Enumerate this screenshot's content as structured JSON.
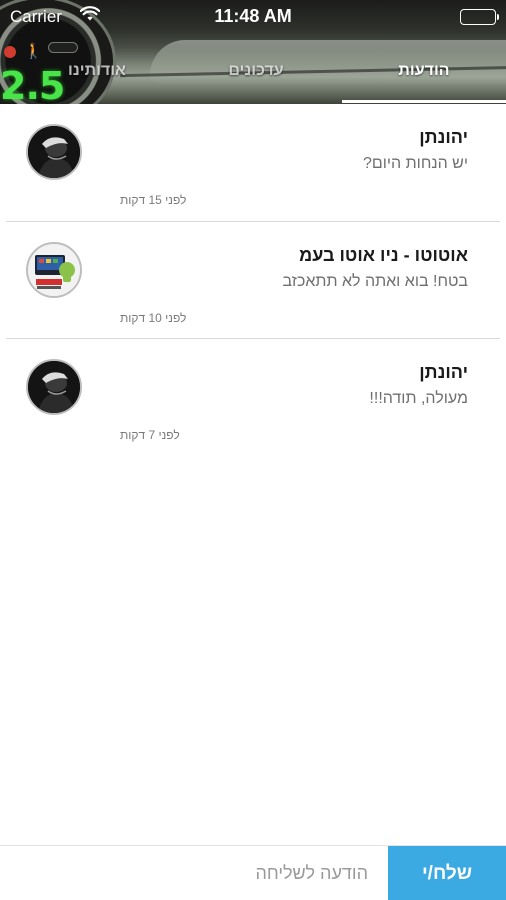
{
  "status_bar": {
    "carrier": "Carrier",
    "time": "11:48 AM",
    "icons": [
      "wifi-icon",
      "battery-icon"
    ]
  },
  "header": {
    "gauge_text": "2.5",
    "tabs": [
      {
        "label": "הודעות",
        "selected": true
      },
      {
        "label": "עדכונים",
        "selected": false
      },
      {
        "label": "אודותינו",
        "selected": false
      }
    ]
  },
  "messages": [
    {
      "name": "יהונתן",
      "preview": "יש הנחות היום?",
      "time": "לפני 15 דקות",
      "avatar": "person-photo"
    },
    {
      "name": "אוטוטו - ניו אוטו בעמ",
      "preview": "בטח! בוא ואתה לא תתאכזב",
      "time": "לפני 10 דקות",
      "avatar": "car-stereo-logo"
    },
    {
      "name": "יהונתן",
      "preview": "מעולה, תודה!!!",
      "time": "לפני 7 דקות",
      "avatar": "person-photo"
    }
  ],
  "composer": {
    "placeholder": "הודעה לשליחה",
    "value": "",
    "send_label": "שלח/י"
  },
  "colors": {
    "accent": "#3ba9e2",
    "tab_indicator": "#ffffff",
    "divider": "#d9d9d9"
  }
}
